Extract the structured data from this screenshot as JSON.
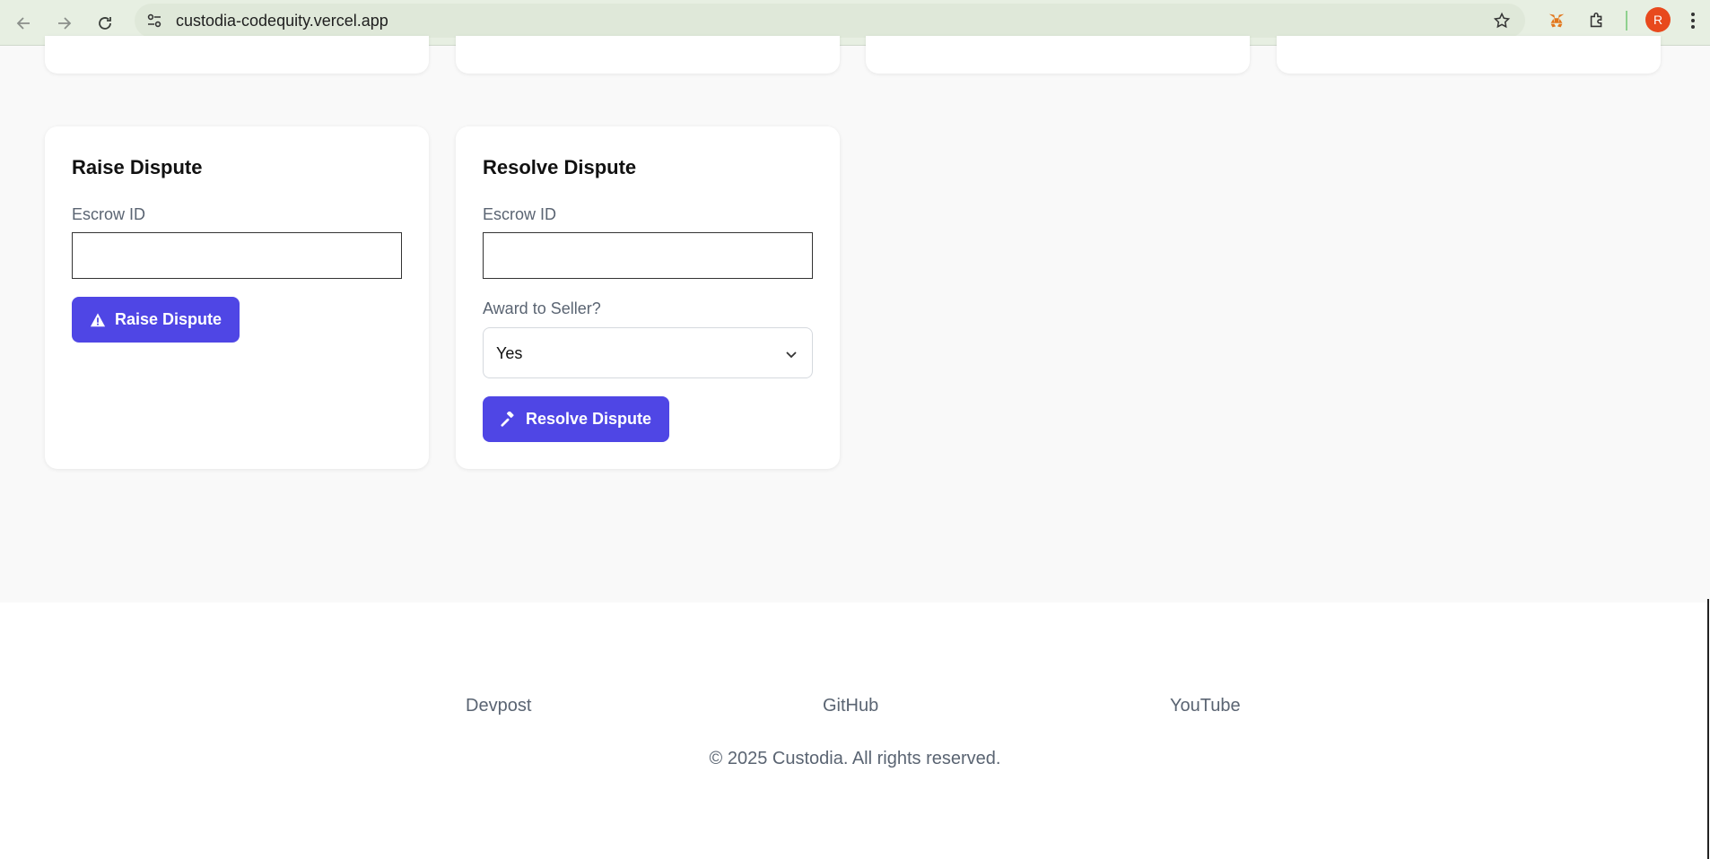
{
  "browser": {
    "url": "custodia-codequity.vercel.app",
    "avatar_letter": "R"
  },
  "raise_dispute": {
    "title": "Raise Dispute",
    "escrow_label": "Escrow ID",
    "escrow_value": "",
    "button_label": "Raise Dispute"
  },
  "resolve_dispute": {
    "title": "Resolve Dispute",
    "escrow_label": "Escrow ID",
    "escrow_value": "",
    "award_label": "Award to Seller?",
    "award_selected": "Yes",
    "button_label": "Resolve Dispute"
  },
  "footer": {
    "links": [
      "Devpost",
      "GitHub",
      "YouTube"
    ],
    "copyright": "© 2025 Custodia. All rights reserved."
  },
  "colors": {
    "primary": "#4f46e5",
    "page_bg": "#f9f9f9",
    "chrome_bg": "#e7efe2"
  }
}
